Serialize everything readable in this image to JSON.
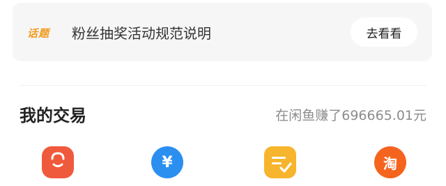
{
  "topic": {
    "tag": "话题",
    "text": "粉丝抽奖活动规范说明",
    "button": "去看看"
  },
  "trade": {
    "title": "我的交易",
    "stat": "在闲鱼赚了696665.01元"
  },
  "icons": [
    {
      "name": "shopping-bag-icon",
      "color": "#f05a3c"
    },
    {
      "name": "yen-icon",
      "color": "#2b8ff0",
      "glyph": "¥"
    },
    {
      "name": "document-check-icon",
      "color": "#f6b52c"
    },
    {
      "name": "taobao-icon",
      "color": "#f5641e",
      "glyph": "淘"
    }
  ]
}
